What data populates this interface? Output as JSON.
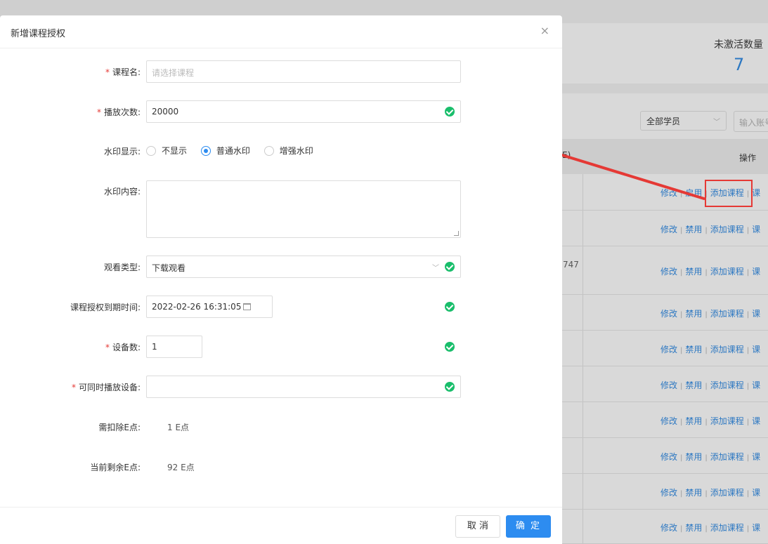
{
  "background": {
    "stat_label": "未激活数量",
    "stat_value": "7",
    "filter_select": "全部学员",
    "search_placeholder": "输入账号",
    "table_header_fragment": "E)",
    "op_header": "操作",
    "cell_fragment": "747",
    "rows": [
      {
        "edit": "修改",
        "toggle": "启用",
        "add_course": "添加课程",
        "more": "课"
      },
      {
        "edit": "修改",
        "toggle": "禁用",
        "add_course": "添加课程",
        "more": "课"
      },
      {
        "edit": "修改",
        "toggle": "禁用",
        "add_course": "添加课程",
        "more": "课"
      },
      {
        "edit": "修改",
        "toggle": "禁用",
        "add_course": "添加课程",
        "more": "课"
      },
      {
        "edit": "修改",
        "toggle": "禁用",
        "add_course": "添加课程",
        "more": "课"
      },
      {
        "edit": "修改",
        "toggle": "禁用",
        "add_course": "添加课程",
        "more": "课"
      },
      {
        "edit": "修改",
        "toggle": "禁用",
        "add_course": "添加课程",
        "more": "课"
      },
      {
        "edit": "修改",
        "toggle": "禁用",
        "add_course": "添加课程",
        "more": "课"
      },
      {
        "edit": "修改",
        "toggle": "禁用",
        "add_course": "添加课程",
        "more": "课"
      },
      {
        "edit": "修改",
        "toggle": "禁用",
        "add_course": "添加课程",
        "more": "课"
      }
    ]
  },
  "modal": {
    "title": "新增课程授权",
    "close": "×",
    "fields": {
      "course_name": {
        "label": "课程名",
        "placeholder": "请选择课程",
        "value": ""
      },
      "play_count": {
        "label": "播放次数",
        "value": "20000"
      },
      "watermark_display": {
        "label": "水印显示",
        "options": [
          "不显示",
          "普通水印",
          "增强水印"
        ],
        "selected": "普通水印"
      },
      "watermark_content": {
        "label": "水印内容",
        "value": ""
      },
      "watch_type": {
        "label": "观看类型",
        "value": "下载观看"
      },
      "expiry": {
        "label": "课程授权到期时间",
        "value": "2022-02-26 16:31:05"
      },
      "device_count": {
        "label": "设备数",
        "value": "1"
      },
      "concurrent_devices": {
        "label": "可同时播放设备",
        "value": ""
      },
      "deduct_points": {
        "label": "需扣除E点",
        "value": "1 E点"
      },
      "remaining_points": {
        "label": "当前剩余E点",
        "value": "92 E点"
      }
    },
    "label_suffix": ":",
    "required_mark": "*",
    "cancel": "取 消",
    "confirm": "确 定"
  },
  "colors": {
    "accent": "#2d8cf0",
    "success": "#19be6b",
    "annotation": "#e53935",
    "link": "#2d78c2"
  }
}
